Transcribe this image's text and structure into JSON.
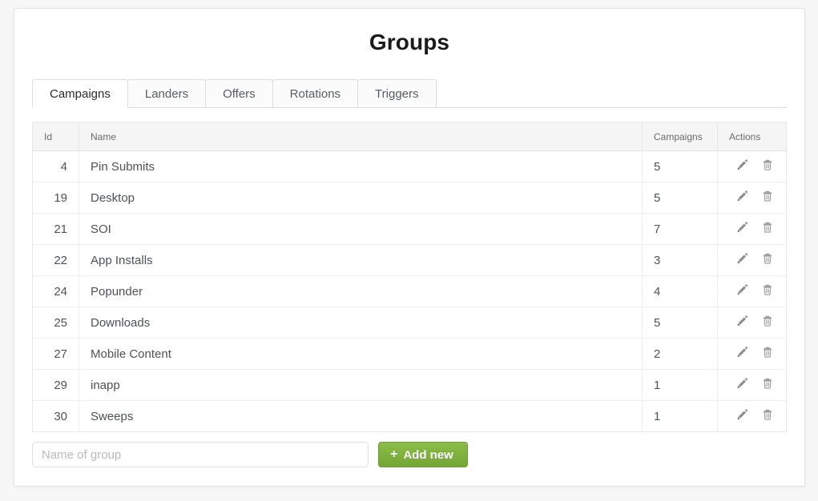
{
  "header": {
    "title": "Groups"
  },
  "tabs": [
    {
      "label": "Campaigns",
      "active": true
    },
    {
      "label": "Landers",
      "active": false
    },
    {
      "label": "Offers",
      "active": false
    },
    {
      "label": "Rotations",
      "active": false
    },
    {
      "label": "Triggers",
      "active": false
    }
  ],
  "table": {
    "columns": [
      "Id",
      "Name",
      "Campaigns",
      "Actions"
    ],
    "rows": [
      {
        "id": "4",
        "name": "Pin Submits",
        "campaigns": "5"
      },
      {
        "id": "19",
        "name": "Desktop",
        "campaigns": "5"
      },
      {
        "id": "21",
        "name": "SOI",
        "campaigns": "7"
      },
      {
        "id": "22",
        "name": "App Installs",
        "campaigns": "3"
      },
      {
        "id": "24",
        "name": "Popunder",
        "campaigns": "4"
      },
      {
        "id": "25",
        "name": "Downloads",
        "campaigns": "5"
      },
      {
        "id": "27",
        "name": "Mobile Content",
        "campaigns": "2"
      },
      {
        "id": "29",
        "name": "inapp",
        "campaigns": "1"
      },
      {
        "id": "30",
        "name": "Sweeps",
        "campaigns": "1"
      }
    ],
    "row_actions": [
      {
        "icon": "pencil-icon",
        "title": "Edit"
      },
      {
        "icon": "trash-icon",
        "title": "Delete"
      }
    ]
  },
  "form": {
    "name_input_value": "",
    "name_input_placeholder": "Name of group",
    "add_button_label": "Add new",
    "add_button_plus": "+"
  },
  "colors": {
    "accent_green": "#7cb03b",
    "page_background": "#f7f7f7",
    "card_background": "#ffffff",
    "table_header_background": "#f5f5f5",
    "border": "#e7e7e7",
    "text": "#4d5256"
  }
}
